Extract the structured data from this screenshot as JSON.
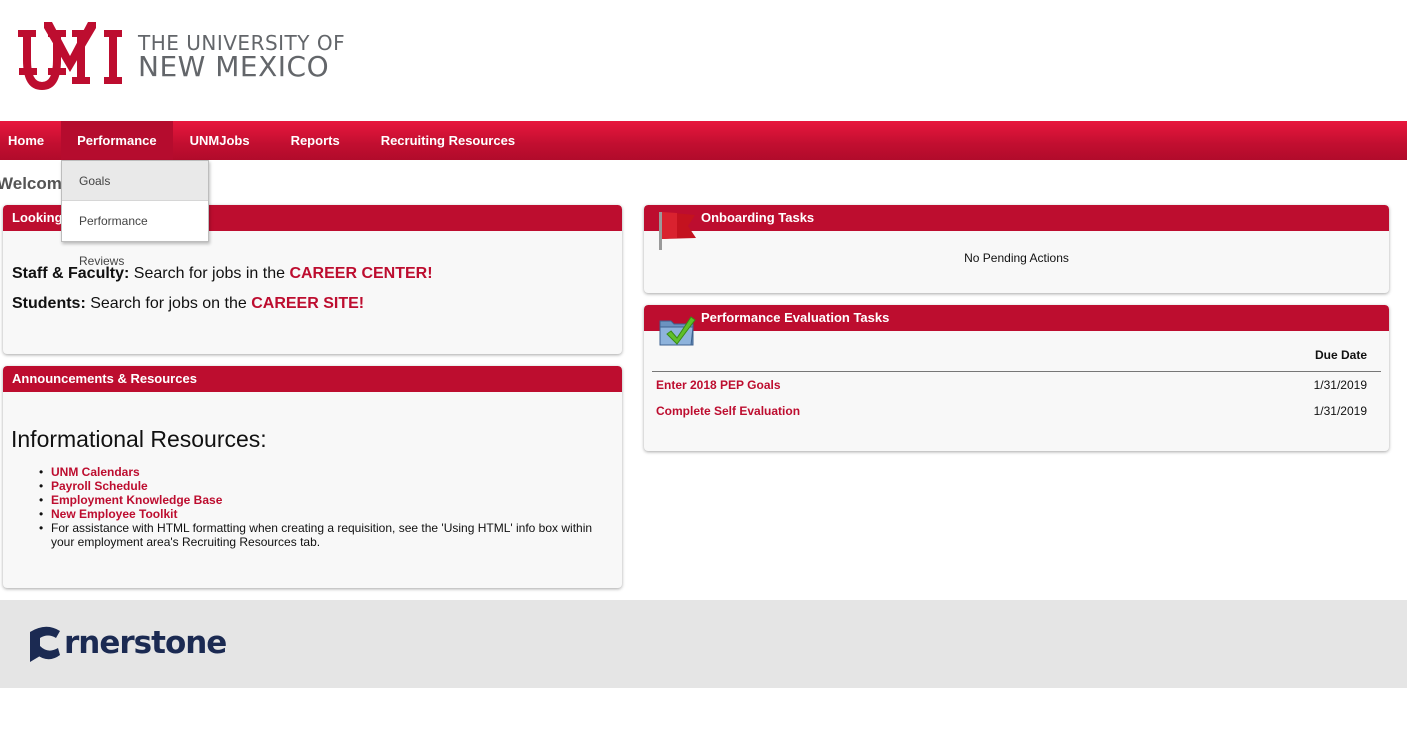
{
  "brand": {
    "university_line1": "THE UNIVERSITY OF",
    "university_line2": "NEW MEXICO",
    "logo_icon": "unm-logo-icon",
    "brand_red": "#bd0d2f"
  },
  "nav": {
    "items": [
      {
        "label": "Home"
      },
      {
        "label": "Performance"
      },
      {
        "label": "UNMJobs"
      },
      {
        "label": "Reports"
      },
      {
        "label": "Recruiting Resources"
      }
    ],
    "dropdown": [
      "Goals",
      "Performance Reviews"
    ]
  },
  "welcome": "Welcome",
  "jobs_panel": {
    "title": "Looking",
    "staff_label": "Staff & Faculty:",
    "staff_text": " Search for jobs in the ",
    "staff_link": "CAREER CENTER!",
    "students_label": "Students:",
    "students_text": " Search for jobs on the ",
    "students_link": "CAREER SITE!"
  },
  "announcements": {
    "title": "Announcements & Resources",
    "heading": "Informational Resources:",
    "links": [
      "UNM Calendars",
      "Payroll Schedule",
      "Employment Knowledge Base",
      "New Employee Toolkit"
    ],
    "note": "For assistance with HTML formatting when creating a requisition, see the 'Using HTML' info box within your employment area's Recruiting Resources tab."
  },
  "onboarding": {
    "title": "Onboarding Tasks",
    "icon": "red-flag-icon",
    "empty_text": "No Pending Actions"
  },
  "performance_tasks": {
    "title": "Performance Evaluation Tasks",
    "icon": "folder-check-icon",
    "due_header": "Due Date",
    "rows": [
      {
        "task": "Enter 2018 PEP Goals",
        "due": "1/31/2019"
      },
      {
        "task": "Complete Self Evaluation",
        "due": "1/31/2019"
      }
    ]
  },
  "footer": {
    "logo_text": "rnerstone",
    "logo_icon": "cornerstone-c-icon"
  }
}
